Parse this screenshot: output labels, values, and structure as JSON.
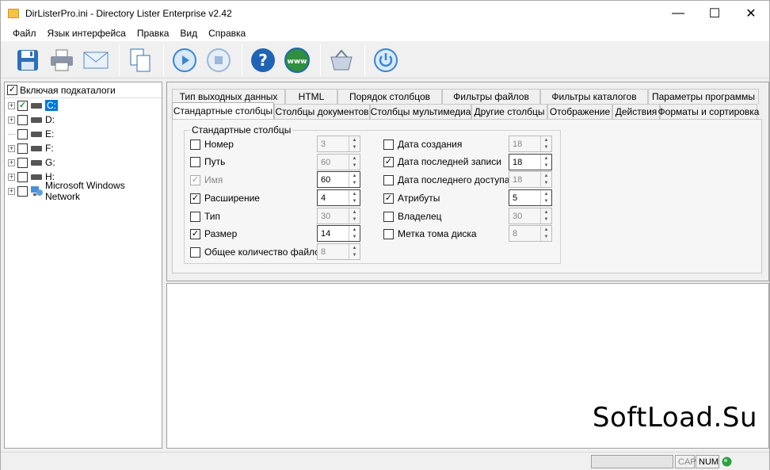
{
  "window": {
    "title": "DirListerPro.ini - Directory Lister Enterprise v2.42",
    "minimize": "—",
    "maximize": "☐",
    "close": "✕"
  },
  "menu": [
    "Файл",
    "Язык интерфейса",
    "Правка",
    "Вид",
    "Справка"
  ],
  "toolbar": [
    "save-icon",
    "print-icon",
    "email-icon",
    "copy-icon",
    "play-icon",
    "stop-icon",
    "help-icon",
    "web-icon",
    "basket-icon",
    "power-icon"
  ],
  "tree": {
    "header": "Включая подкаталоги",
    "nodes": [
      {
        "label": "C:",
        "checked": true
      },
      {
        "label": "D:",
        "checked": false
      },
      {
        "label": "E:",
        "checked": false
      },
      {
        "label": "F:",
        "checked": false
      },
      {
        "label": "G:",
        "checked": false
      },
      {
        "label": "H:",
        "checked": false
      },
      {
        "label": "Microsoft Windows Network",
        "checked": false
      }
    ]
  },
  "tabs_row1": [
    "Тип выходных данных",
    "HTML",
    "Порядок столбцов",
    "Фильтры файлов",
    "Фильтры каталогов",
    "Параметры программы"
  ],
  "tabs_row2": [
    "Стандартные столбцы",
    "Столбцы документов",
    "Столбцы мультимедиа",
    "Другие столбцы",
    "Отображение",
    "Действия",
    "Форматы и сортировка"
  ],
  "group": {
    "title": "Стандартные столбцы",
    "left": [
      {
        "label": "Номер",
        "checked": false,
        "value": "3",
        "enabled": false
      },
      {
        "label": "Путь",
        "checked": false,
        "value": "60",
        "enabled": false
      },
      {
        "label": "Имя",
        "checked": true,
        "value": "60",
        "enabled": true,
        "disabled_check": true
      },
      {
        "label": "Расширение",
        "checked": true,
        "value": "4",
        "enabled": true
      },
      {
        "label": "Тип",
        "checked": false,
        "value": "30",
        "enabled": false
      },
      {
        "label": "Размер",
        "checked": true,
        "value": "14",
        "enabled": true
      },
      {
        "label": "Общее количество файлов",
        "checked": false,
        "value": "8",
        "enabled": false
      }
    ],
    "right": [
      {
        "label": "Дата создания",
        "checked": false,
        "value": "18",
        "enabled": false
      },
      {
        "label": "Дата последней записи",
        "checked": true,
        "value": "18",
        "enabled": true
      },
      {
        "label": "Дата последнего доступа",
        "checked": false,
        "value": "18",
        "enabled": false
      },
      {
        "label": "Атрибуты",
        "checked": true,
        "value": "5",
        "enabled": true
      },
      {
        "label": "Владелец",
        "checked": false,
        "value": "30",
        "enabled": false
      },
      {
        "label": "Метка тома диска",
        "checked": false,
        "value": "8",
        "enabled": false
      }
    ]
  },
  "watermark": "SoftLoad.Su",
  "status": {
    "cap": "CAP",
    "num": "NUM"
  }
}
